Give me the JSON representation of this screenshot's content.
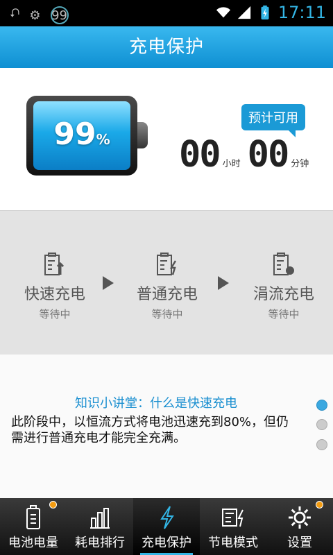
{
  "status": {
    "time": "17:11",
    "badge": "99",
    "icons": [
      "usb-icon",
      "android-icon",
      "badge-99-icon",
      "wifi-icon",
      "signal-icon",
      "battery-charging-icon"
    ]
  },
  "title": "充电保护",
  "battery": {
    "percent": "99",
    "percent_unit": "%",
    "level_fraction": 0.99
  },
  "estimate": {
    "bubble": "预计可用",
    "hours": "00",
    "hours_unit": "小时",
    "minutes": "00",
    "minutes_unit": "分钟"
  },
  "stages": [
    {
      "name": "快速充电",
      "state": "等待中",
      "icon": "fast-charge-icon"
    },
    {
      "name": "普通充电",
      "state": "等待中",
      "icon": "normal-charge-icon"
    },
    {
      "name": "涓流充电",
      "state": "等待中",
      "icon": "trickle-charge-icon"
    }
  ],
  "knowledge": {
    "title": "知识小讲堂：什么是快速充电",
    "body": "此阶段中，以恒流方式将电池迅速充到80%，但仍需进行普通充电才能完全充满。",
    "pages": 3,
    "active_page": 1
  },
  "nav": [
    {
      "label": "电池电量",
      "icon": "battery-icon",
      "dot": true
    },
    {
      "label": "耗电排行",
      "icon": "bar-chart-icon",
      "dot": false
    },
    {
      "label": "充电保护",
      "icon": "lightning-icon",
      "dot": false,
      "active": true
    },
    {
      "label": "节电模式",
      "icon": "power-save-icon",
      "dot": false
    },
    {
      "label": "设置",
      "icon": "settings-gear-icon",
      "dot": true
    }
  ],
  "colors": {
    "accent": "#33b5e5",
    "title_bar": "#1ea3e3",
    "knowledge_title": "#1a8fd0"
  }
}
